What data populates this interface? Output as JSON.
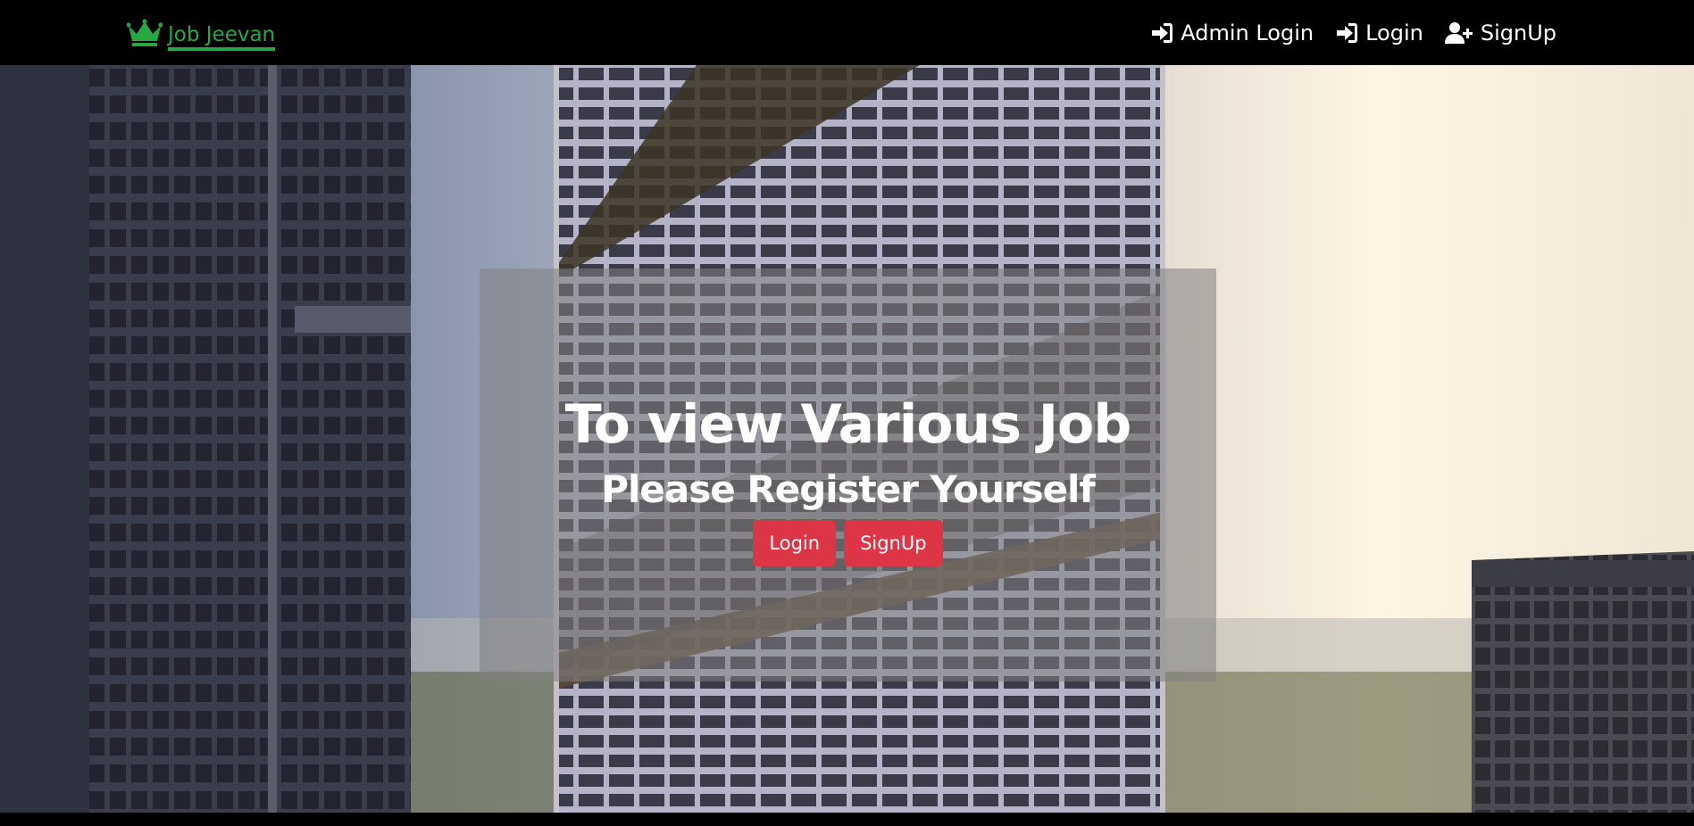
{
  "brand": {
    "name": "Job Jeevan",
    "color": "#28a745",
    "icon": "crown-icon"
  },
  "nav": {
    "items": [
      {
        "label": "Admin Login",
        "icon": "sign-in-icon"
      },
      {
        "label": "Login",
        "icon": "sign-in-icon"
      },
      {
        "label": "SignUp",
        "icon": "user-plus-icon"
      }
    ]
  },
  "hero": {
    "headline": "To view Various Job",
    "subheadline": "Please Register Yourself",
    "buttons": {
      "login": "Login",
      "signup": "SignUp"
    },
    "button_color": "#dc3545",
    "background": "city skyscraper photo"
  }
}
